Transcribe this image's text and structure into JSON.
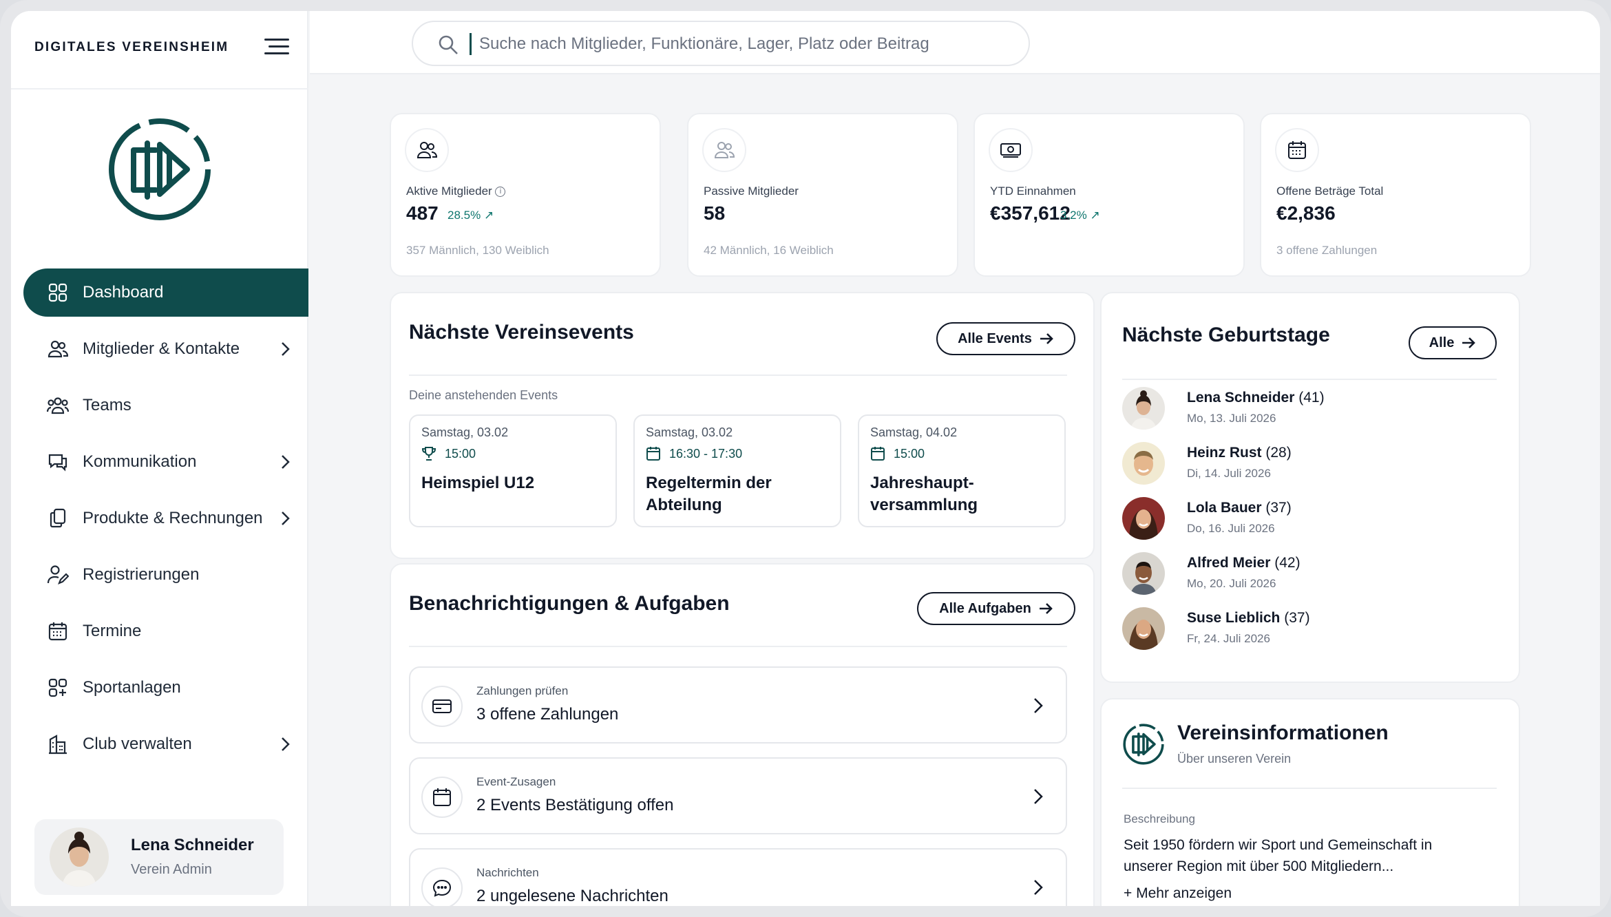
{
  "brand": "DIGITALES VEREINSHEIM",
  "colors": {
    "accent": "#0f4c4c",
    "trend": "#0f766e"
  },
  "search": {
    "placeholder": "Suche nach Mitglieder, Funktionäre, Lager, Platz oder Beitrag"
  },
  "sidebar": {
    "items": [
      {
        "label": "Dashboard",
        "icon": "grid-icon"
      },
      {
        "label": "Mitglieder & Kontakte",
        "icon": "users-icon"
      },
      {
        "label": "Teams",
        "icon": "team-icon"
      },
      {
        "label": "Kommunikation",
        "icon": "chat-icon"
      },
      {
        "label": "Produkte & Rechnungen",
        "icon": "documents-icon"
      },
      {
        "label": "Registrierungen",
        "icon": "user-edit-icon"
      },
      {
        "label": "Termine",
        "icon": "calendar-icon"
      },
      {
        "label": "Sportanlagen",
        "icon": "apps-icon"
      },
      {
        "label": "Club verwalten",
        "icon": "building-icon"
      }
    ]
  },
  "user": {
    "name": "Lena Schneider",
    "role": "Verein Admin"
  },
  "stats": [
    {
      "label": "Aktive Mitglieder",
      "value": "487",
      "trend": "28.5%",
      "sub": "357 Männlich, 130 Weiblich"
    },
    {
      "label": "Passive Mitglieder",
      "value": "58",
      "trend": "",
      "sub": "42 Männlich, 16 Weiblich"
    },
    {
      "label": "YTD Einnahmen",
      "value": "€357,612",
      "trend": "3.2%",
      "sub": ""
    },
    {
      "label": "Offene Beträge Total",
      "value": "€2,836",
      "trend": "",
      "sub": "3 offene Zahlungen"
    }
  ],
  "events": {
    "title": "Nächste Vereinsevents",
    "button": "Alle Events",
    "subtitle": "Deine anstehenden Events",
    "items": [
      {
        "date": "Samstag, 03.02",
        "time": "15:00",
        "title": "Heimspiel U12"
      },
      {
        "date": "Samstag, 03.02",
        "time": "16:30 - 17:30",
        "title": "Regeltermin der Abteilung"
      },
      {
        "date": "Samstag, 04.02",
        "time": "15:00",
        "title": "Jahreshaupt-versammlung"
      }
    ]
  },
  "tasks": {
    "title": "Benachrichtigungen & Aufgaben",
    "button": "Alle Aufgaben",
    "items": [
      {
        "category": "Zahlungen prüfen",
        "text": "3 offene Zahlungen"
      },
      {
        "category": "Event-Zusagen",
        "text": "2 Events Bestätigung offen"
      },
      {
        "category": "Nachrichten",
        "text": "2 ungelesene Nachrichten"
      }
    ]
  },
  "birthdays": {
    "title": "Nächste Geburtstage",
    "button": "Alle",
    "items": [
      {
        "name": "Lena Schneider",
        "age": "(41)",
        "date": "Mo, 13. Juli 2026"
      },
      {
        "name": "Heinz Rust",
        "age": "(28)",
        "date": "Di, 14. Juli 2026"
      },
      {
        "name": "Lola Bauer",
        "age": "(37)",
        "date": "Do, 16. Juli 2026"
      },
      {
        "name": "Alfred Meier",
        "age": "(42)",
        "date": "Mo, 20. Juli 2026"
      },
      {
        "name": "Suse Lieblich",
        "age": "(37)",
        "date": "Fr, 24. Juli 2026"
      }
    ]
  },
  "vereinsinfo": {
    "title": "Vereinsinformationen",
    "subtitle": "Über unseren Verein",
    "label": "Beschreibung",
    "description": "Seit 1950 fördern wir Sport und Gemeinschaft in unserer Region mit über 500 Mitgliedern...",
    "more": "+ Mehr anzeigen"
  }
}
